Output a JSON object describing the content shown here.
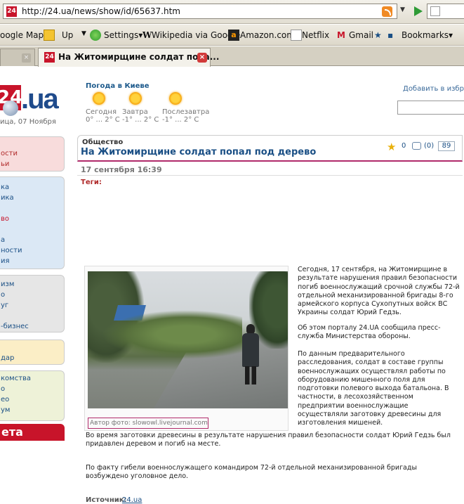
{
  "browser": {
    "url": "http://24.ua/news/show/id/65637.htm",
    "bookmarks": [
      {
        "label": "oogle Maps"
      },
      {
        "label": "Up"
      },
      {
        "label": "Settings▾"
      },
      {
        "label": "Wikipedia via Google"
      },
      {
        "label": "Amazon.com"
      },
      {
        "label": "Netflix"
      },
      {
        "label": "Gmail"
      },
      {
        "label": "Bookmarks▾"
      }
    ],
    "tabs": [
      {
        "label": "",
        "active": false
      },
      {
        "label": "На Житомирщине солдат попа...",
        "active": true
      }
    ]
  },
  "header": {
    "logo_text": ".ua",
    "logo_mark": "24",
    "date": "ица, 07 Ноября",
    "weather_title": "Погода в Киеве",
    "weather": [
      {
        "day": "Сегодня",
        "temp": "0° ... 2° C"
      },
      {
        "day": "Завтра",
        "temp": "-1° ... 2° C"
      },
      {
        "day": "Послезавтра",
        "temp": "-1° ... 2° C"
      }
    ],
    "add_favorites": "Добавить в избранн"
  },
  "sidebar": {
    "red": [
      "ости",
      "ьи"
    ],
    "blue": [
      "ка",
      "ика",
      "",
      "во",
      "",
      "а",
      "ности",
      "ия"
    ],
    "gray": [
      "изм",
      "о",
      "уг",
      "",
      "-бизнес"
    ],
    "yellow": [
      "",
      "дар"
    ],
    "green": [
      "комства",
      "о",
      "ео",
      "ум"
    ],
    "gazeta": "ета"
  },
  "article": {
    "rubric": "Общество",
    "headline": "На Житомирщине солдат попал под дерево",
    "fav_count": "0",
    "comment_count": "(0)",
    "views": "89",
    "date": "17 сентября 16:39",
    "tags_label": "Теги:",
    "photo_credit": "Автор фото: slowowl.livejournal.com",
    "paragraphs_side": [
      "Сегодня, 17 сентября, на Житомирщине в результате нарушения правил безопасности погиб военнослужащий срочной службы 72-й отдельной механизированной бригады 8-го армейского корпуса Сухопутных войск ВС Украины солдат Юрий Гедзь.",
      "Об этом порталу 24.UA сообщила пресс-служба Министерства обороны.",
      "По данным предварительного расследования, солдат в составе группы военнослужащих осуществлял работы по оборудованию мишенного поля для подготовки полевого выхода батальона. В частности, в лесохозяйственном предприятии военнослужащие осуществляли заготовку древесины для изготовления мишеней."
    ],
    "paragraphs_full": [
      "Во время заготовки древесины в результате нарушения правил безопасности солдат Юрий Гедзь был придавлен деревом и погиб на месте.",
      "По факту гибели военнослужащего командиром 72-й отдельной механизированной бригады возбуждено уголовное дело."
    ],
    "source_label": "Источник:",
    "source_link": "24.ua"
  }
}
